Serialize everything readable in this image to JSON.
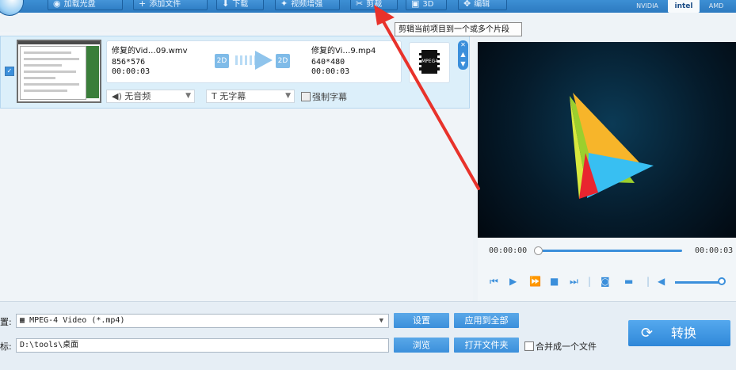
{
  "toolbar": {
    "buttons": [
      {
        "label": "加载光盘"
      },
      {
        "label": "添加文件"
      },
      {
        "label": "下载"
      },
      {
        "label": "视频增强"
      },
      {
        "label": "剪裁"
      },
      {
        "label": "3D"
      },
      {
        "label": "编辑"
      }
    ],
    "gpu": [
      "NVIDIA",
      "intel",
      "AMD"
    ]
  },
  "tooltip": "剪辑当前项目到一个或多个片段",
  "file": {
    "src_name": "修复的Vid…09.wmv",
    "src_res": "856*576",
    "src_dur": "00:00:03",
    "dst_name": "修复的Vi…9.mp4",
    "dst_res": "640*480",
    "dst_dur": "00:00:03",
    "badge": "2D",
    "format_icon": "MPEG4",
    "audio": "无音频",
    "subtitle": "无字幕",
    "force_sub": "强制字幕"
  },
  "player": {
    "time_start": "00:00:00",
    "time_end": "00:00:03",
    "progress": 0.0,
    "volume": 1.0
  },
  "bottom": {
    "preset_label": "置:",
    "preset_value": "MPEG-4 Video (*.mp4)",
    "settings": "设置",
    "apply_all": "应用到全部",
    "dest_label": "标:",
    "dest_value": "D:\\tools\\桌面",
    "browse": "浏览",
    "open_folder": "打开文件夹",
    "merge": "合并成一个文件",
    "convert": "转换"
  },
  "colors": {
    "accent": "#3b8fdb",
    "annotation": "#e8322b"
  }
}
